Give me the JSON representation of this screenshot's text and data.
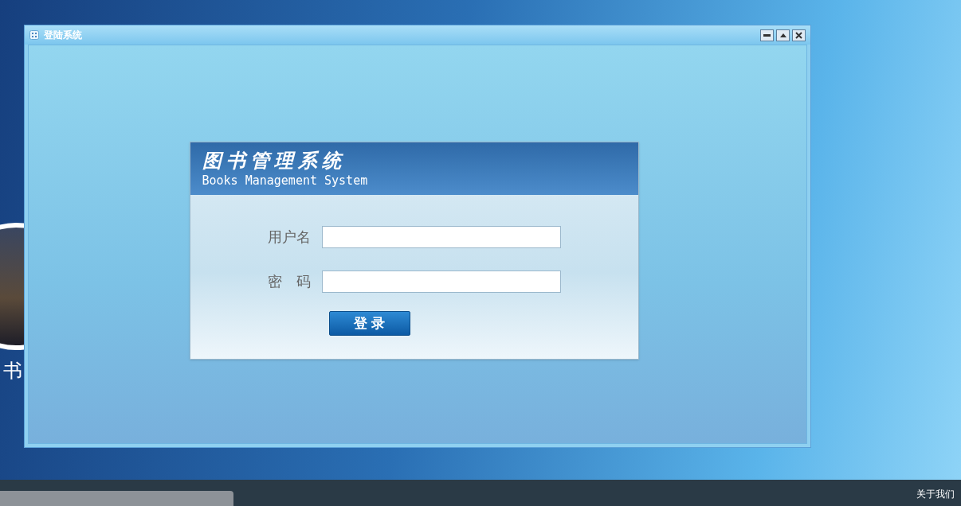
{
  "desktop": {
    "icon_label": "书"
  },
  "window": {
    "title": "登陆系统"
  },
  "login": {
    "title_cn": "图书管理系统",
    "title_en": "Books Management System",
    "fields": [
      {
        "label": "用户名"
      },
      {
        "label": "密　码"
      }
    ],
    "button": "登 录"
  },
  "taskbar": {
    "link": "关于我们"
  }
}
